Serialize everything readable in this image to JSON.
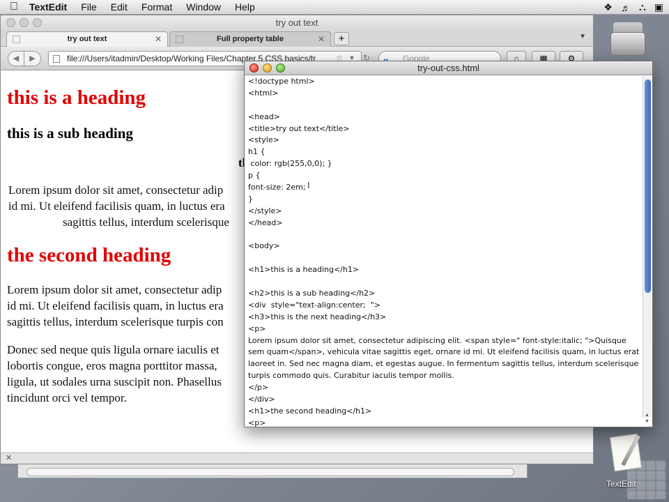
{
  "menubar": {
    "app_name": "TextEdit",
    "menus": [
      "File",
      "Edit",
      "Format",
      "Window",
      "Help"
    ]
  },
  "browser": {
    "window_title": "try out text",
    "tabs": [
      {
        "label": "try out text",
        "active": true
      },
      {
        "label": "Full property table",
        "active": false
      }
    ],
    "new_tab_label": "+",
    "url": "file:///Users/itadmin/Desktop/Working Files/Chapter 5 CSS basics/tr",
    "search_placeholder": "Google",
    "page": {
      "heading1": "this is a heading",
      "heading2": "this is a sub heading",
      "heading3": "th",
      "para1_lines": [
        "Lorem ipsum dolor sit amet, consectetur adip",
        "id mi. Ut eleifend facilisis quam, in luctus era",
        "sagittis tellus, interdum scelerisque"
      ],
      "heading_second": "the second heading",
      "para2_lines": [
        "Lorem ipsum dolor sit amet, consectetur adip",
        "id mi. Ut eleifend facilisis quam, in luctus era",
        "sagittis tellus, interdum scelerisque turpis con"
      ],
      "para3_lines": [
        "Donec sed neque quis ligula ornare iaculis et",
        "lobortis congue, eros magna porttitor massa,",
        "ligula, ut sodales urna suscipit non. Phasellus",
        "tincidunt orci vel tempor."
      ]
    }
  },
  "textedit": {
    "window_title": "try-out-css.html",
    "lines": [
      "<!doctype html>",
      "<html>",
      "",
      "<head>",
      "<title>try out text</title>",
      "<style>",
      "h1 {",
      " color: rgb(255,0,0); }",
      "p {",
      "font-size: 2em;",
      "}",
      "</style>",
      "</head>",
      "",
      "<body>",
      "",
      "<h1>this is a heading</h1>",
      "",
      "<h2>this is a sub heading</h2>",
      "<div  style=\"text-align:center;  \">",
      "<h3>this is the next heading</h3>",
      "<p>",
      "Lorem ipsum dolor sit amet, consectetur adipiscing elit. <span style=\" font-style:italic; \">Quisque",
      "sem quam</span>, vehicula vitae sagittis eget, ornare id mi. Ut eleifend facilisis quam, in luctus erat",
      "laoreet in. Sed nec magna diam, et egestas augue. In fermentum sagittis tellus, interdum scelerisque",
      "turpis commodo quis. Curabitur iaculis tempor mollis.",
      "</p>",
      "</div>",
      "<h1>the second heading</h1>",
      "<p>"
    ]
  },
  "dock": {
    "textedit_label": "TextEdit"
  },
  "colors": {
    "heading_red": "#e00000",
    "scroll_thumb": "#3c68c0"
  }
}
